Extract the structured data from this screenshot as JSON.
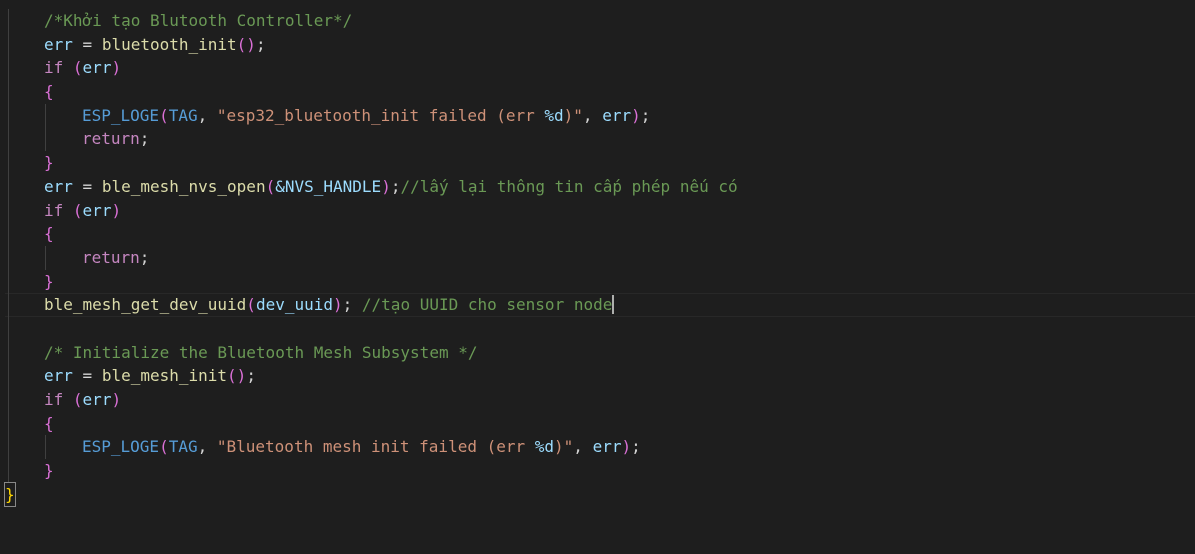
{
  "code": {
    "comment_init_controller": "/*Khởi tạo Blutooth Controller*/",
    "var_err": "err",
    "op_assign": " = ",
    "fn_bluetooth_init": "bluetooth_init",
    "kw_if": "if",
    "macro_loge": "ESP_LOGE",
    "tag": "TAG",
    "str_bt_init_failed_a": "\"esp32_bluetooth_init failed (err ",
    "fmt_d": "%d",
    "str_close": ")\"",
    "kw_return": "return",
    "fn_nvs_open": "ble_mesh_nvs_open",
    "nvs_handle": "&NVS_HANDLE",
    "comment_nvs": "//lấy lại thông tin cấp phép nếu có",
    "fn_get_uuid": "ble_mesh_get_dev_uuid",
    "var_dev_uuid": "dev_uuid",
    "comment_uuid": "//tạo UUID cho sensor node",
    "comment_init_mesh": "/* Initialize the Bluetooth Mesh Subsystem */",
    "fn_mesh_init": "ble_mesh_init",
    "str_mesh_init_failed_a": "\"Bluetooth mesh init failed (err "
  }
}
